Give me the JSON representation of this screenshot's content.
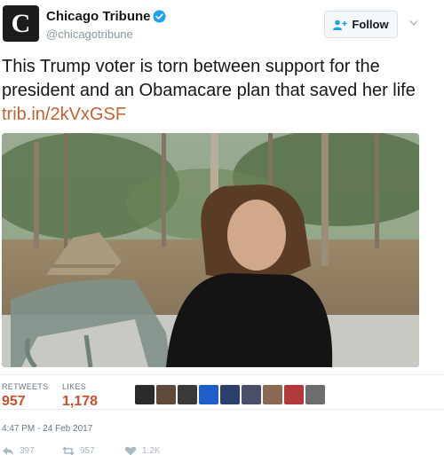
{
  "account": {
    "name": "Chicago Tribune",
    "handle": "@chicagotribune",
    "avatar_glyph": "C",
    "verified": true,
    "follow_label": "Follow",
    "brand_color": "#c9512f"
  },
  "tweet": {
    "text": "This Trump voter is torn between support for the president and an Obamacare plan that saved her life",
    "link": "trib.in/2kVxGSF"
  },
  "stats": {
    "retweets_label": "RETWEETS",
    "retweets_value": "957",
    "likes_label": "LIKES",
    "likes_value": "1,178"
  },
  "timestamp": "4:47 PM - 24 Feb 2017",
  "actions": {
    "reply_count": "397",
    "retweet_count": "957",
    "like_count": "1.2K"
  },
  "icons": [
    "verified-icon",
    "follow-person-icon",
    "chevron-down-icon",
    "reply-icon",
    "retweet-icon",
    "heart-icon"
  ]
}
